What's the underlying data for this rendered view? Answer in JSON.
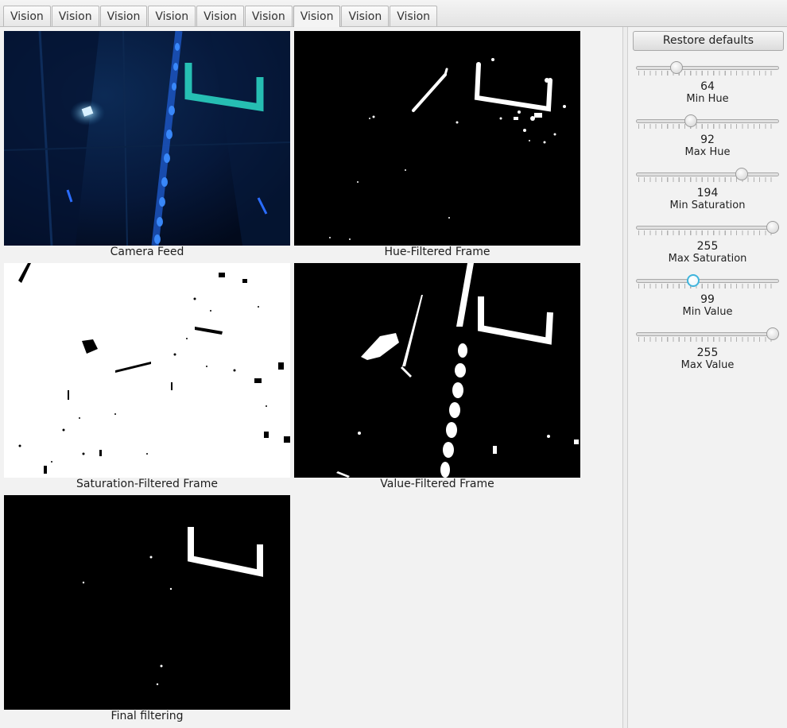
{
  "tabs": [
    "Vision",
    "Vision",
    "Vision",
    "Vision",
    "Vision",
    "Vision",
    "Vision",
    "Vision",
    "Vision"
  ],
  "active_tab_index": 6,
  "panels": {
    "camera_feed": "Camera Feed",
    "hue_filtered": "Hue-Filtered Frame",
    "saturation_filtered": "Saturation-Filtered Frame",
    "value_filtered": "Value-Filtered Frame",
    "final_filtering": "Final filtering"
  },
  "controls": {
    "restore_defaults": "Restore defaults",
    "sliders": [
      {
        "label": "Min Hue",
        "value": "64",
        "fraction": 0.26
      },
      {
        "label": "Max Hue",
        "value": "92",
        "fraction": 0.37
      },
      {
        "label": "Min Saturation",
        "value": "194",
        "fraction": 0.76
      },
      {
        "label": "Max Saturation",
        "value": "255",
        "fraction": 1.0
      },
      {
        "label": "Min Value",
        "value": "99",
        "fraction": 0.39
      },
      {
        "label": "Max Value",
        "value": "255",
        "fraction": 1.0
      }
    ]
  },
  "colors": {
    "accent": "#3fb4dc",
    "target_glow": "#2ad0c0",
    "led_blue": "#2a6cff"
  }
}
